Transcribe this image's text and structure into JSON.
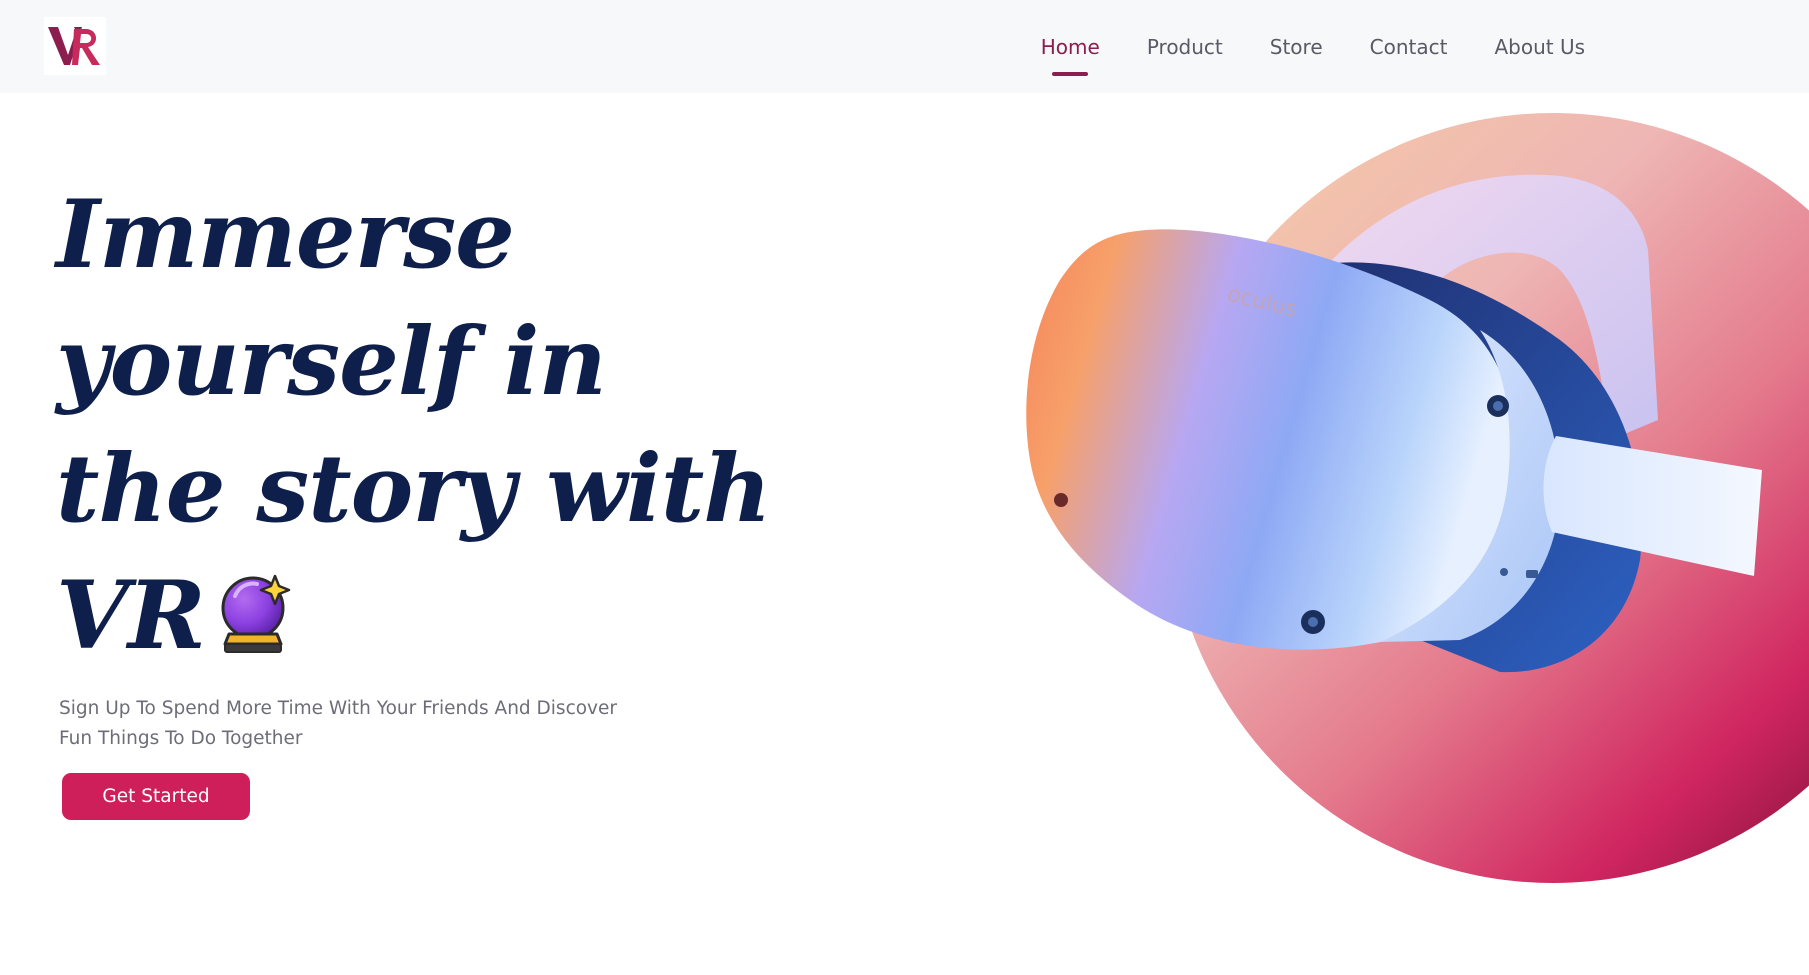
{
  "header": {
    "logo_text": "VR",
    "nav": [
      {
        "label": "Home",
        "active": true
      },
      {
        "label": "Product",
        "active": false
      },
      {
        "label": "Store",
        "active": false
      },
      {
        "label": "Contact",
        "active": false
      },
      {
        "label": "About Us",
        "active": false
      }
    ]
  },
  "hero": {
    "title_lines": [
      "Immerse",
      "yourself in",
      "the story with",
      "VR"
    ],
    "title_icon": "crystal-ball-icon",
    "subtitle_lines": [
      "Sign Up To Spend More Time With Your Friends And Discover",
      "Fun Things To Do Together"
    ],
    "cta_label": "Get Started",
    "headset_brand": "oculus"
  },
  "colors": {
    "accent": "#cf1f5a",
    "nav_active": "#8c1d4f",
    "title": "#0d1f4a",
    "nav_text": "#5a5a66",
    "header_bg": "#f7f8fa"
  }
}
